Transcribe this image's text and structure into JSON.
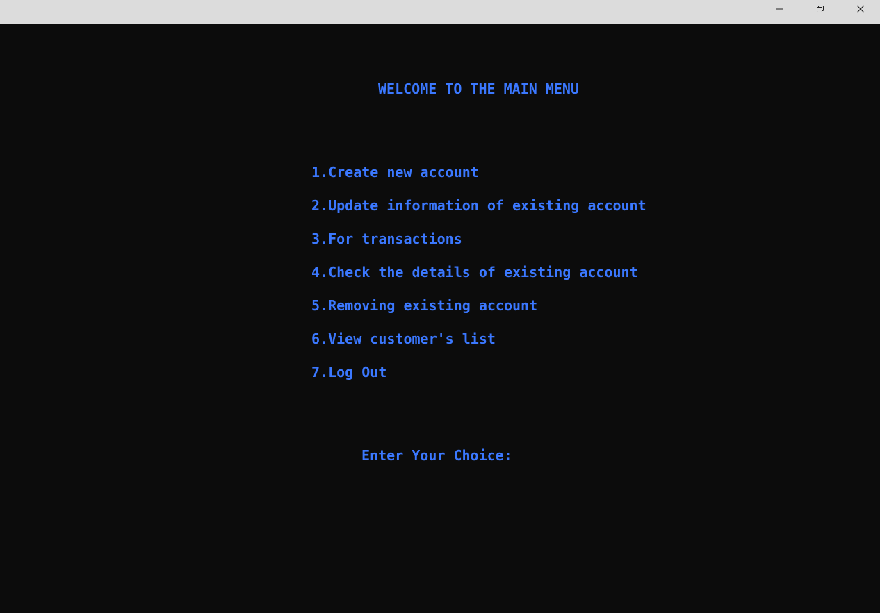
{
  "window": {
    "controls": {
      "minimize_icon": "minimize-icon",
      "maximize_icon": "restore-icon",
      "close_icon": "close-icon"
    }
  },
  "console": {
    "text_color": "#3b78ff",
    "background_color": "#0c0c0c",
    "title": "WELCOME TO THE MAIN MENU",
    "menu_items": [
      "1.Create new account",
      "2.Update information of existing account",
      "3.For transactions",
      "4.Check the details of existing account",
      "5.Removing existing account",
      "6.View customer's list",
      "7.Log Out"
    ],
    "prompt": "Enter Your Choice:"
  }
}
